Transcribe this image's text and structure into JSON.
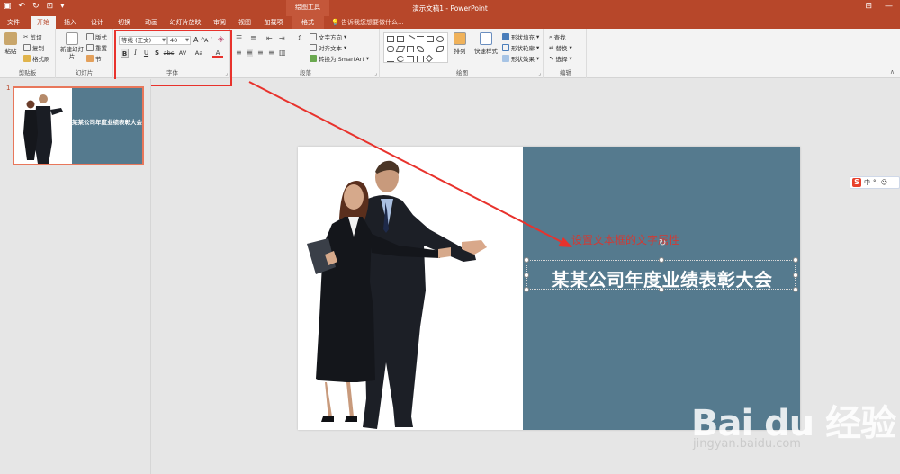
{
  "titlebar": {
    "context_tools": "绘图工具",
    "doc_title": "演示文稿1 - PowerPoint",
    "bg": "#b7472a"
  },
  "tabs": [
    {
      "label": "文件"
    },
    {
      "label": "开始"
    },
    {
      "label": "插入"
    },
    {
      "label": "设计"
    },
    {
      "label": "切换"
    },
    {
      "label": "动画"
    },
    {
      "label": "幻灯片放映"
    },
    {
      "label": "审阅"
    },
    {
      "label": "视图"
    },
    {
      "label": "加载项"
    },
    {
      "label": "格式"
    }
  ],
  "tell_me": "告诉我您想要做什么...",
  "ribbon": {
    "clipboard": {
      "paste": "粘贴",
      "cut": "剪切",
      "copy": "复制",
      "format_painter": "格式刷",
      "label": "剪贴板"
    },
    "slides": {
      "new_slide": "新建幻灯片",
      "layout": "版式",
      "reset": "重置",
      "section": "节",
      "label": "幻灯片"
    },
    "font": {
      "font_name": "等线 (正文)",
      "font_size": "40",
      "label": "字体",
      "bold": "B",
      "italic": "I",
      "underline": "U",
      "shadow": "S",
      "strike": "abc",
      "spacing": "AV",
      "case": "Aa",
      "color": "A",
      "grow": "A",
      "shrink": "A"
    },
    "paragraph": {
      "text_direction": "文字方向",
      "align_text": "对齐文本",
      "convert_smartart": "转换为 SmartArt",
      "label": "段落"
    },
    "drawing": {
      "arrange": "排列",
      "quick_styles": "快速样式",
      "shape_fill": "形状填充",
      "shape_outline": "形状轮廓",
      "shape_effects": "形状效果",
      "label": "绘图"
    },
    "editing": {
      "find": "查找",
      "replace": "替换",
      "select": "选择",
      "label": "编辑"
    }
  },
  "thumbnail": {
    "number": "1",
    "title": "某某公司年度业绩表彰大会"
  },
  "slide": {
    "title": "某某公司年度业绩表彰大会",
    "panel_color": "#557a8e",
    "annotation": "设置文本框的文字属性"
  },
  "ime": {
    "mode": "中"
  },
  "watermark": {
    "logo": "Bai du 经验",
    "url": "jingyan.baidu.com"
  },
  "colors": {
    "accent": "#b7472a",
    "highlight_red": "#e8322c"
  }
}
